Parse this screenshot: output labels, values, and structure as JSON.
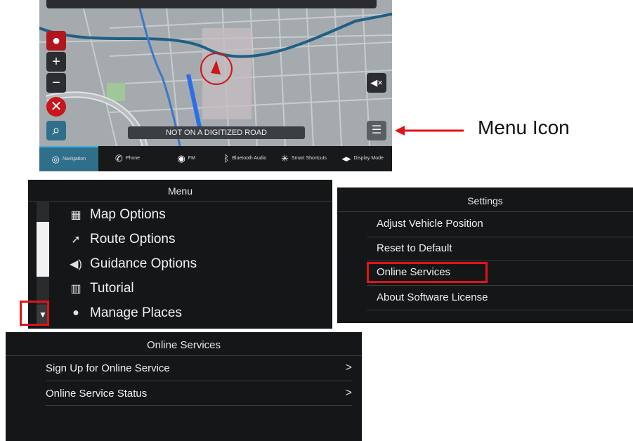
{
  "map": {
    "road_banner": "NOT ON A DIGITIZED ROAD",
    "bottom_bar": [
      {
        "label": "Navigation",
        "icon": "navigation-icon",
        "active": true
      },
      {
        "label": "Phone",
        "icon": "phone-icon",
        "active": false
      },
      {
        "label": "FM",
        "icon": "radio-icon",
        "active": false
      },
      {
        "label": "Bluetooth Audio",
        "icon": "bluetooth-icon",
        "active": false
      },
      {
        "label": "Smart Shortcuts",
        "icon": "shortcuts-icon",
        "active": false
      },
      {
        "label": "Display Mode",
        "icon": "display-mode-icon",
        "active": false
      }
    ]
  },
  "callout": {
    "label": "Menu Icon",
    "color": "#e0131a"
  },
  "menu": {
    "title": "Menu",
    "items": [
      {
        "label": "Map Options",
        "icon": "map-icon"
      },
      {
        "label": "Route Options",
        "icon": "route-icon"
      },
      {
        "label": "Guidance Options",
        "icon": "speaker-icon"
      },
      {
        "label": "Tutorial",
        "icon": "book-icon"
      },
      {
        "label": "Manage Places",
        "icon": "person-icon"
      }
    ]
  },
  "settings": {
    "title": "Settings",
    "items": [
      "Adjust Vehicle Position",
      "Reset to Default",
      "Online Services",
      "About Software License"
    ]
  },
  "online_services": {
    "title": "Online Services",
    "items": [
      "Sign Up for Online Service",
      "Online Service Status"
    ]
  },
  "colors": {
    "panel_bg": "#151617",
    "highlight": "#e0131a",
    "route_blue": "#2a6fe8",
    "active_tab": "#2f6f8a"
  }
}
